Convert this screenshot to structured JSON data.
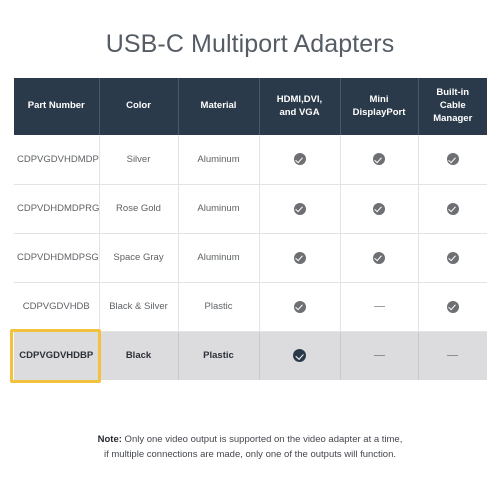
{
  "title": "USB-C Multiport Adapters",
  "colors": {
    "header_bg": "#2b3a4a",
    "highlight_border": "#f2c23e",
    "highlight_row_bg": "#dcdcde",
    "check_gray": "#6d6f72",
    "check_dark": "#2b3a4a",
    "title_text": "#555c66"
  },
  "table": {
    "columns": [
      {
        "label": "Part Number"
      },
      {
        "label": "Color"
      },
      {
        "label": "Material"
      },
      {
        "label": "HDMI,DVI,\nand VGA"
      },
      {
        "label": "Mini\nDisplayPort"
      },
      {
        "label": "Built-in Cable\nManager"
      }
    ],
    "column_labels_lines": [
      [
        "Part Number"
      ],
      [
        "Color"
      ],
      [
        "Material"
      ],
      [
        "HDMI,DVI,",
        "and VGA"
      ],
      [
        "Mini",
        "DisplayPort"
      ],
      [
        "Built-in Cable",
        "Manager"
      ]
    ],
    "rows": [
      {
        "part_number": "CDPVGDVHDMDP",
        "color": "Silver",
        "material": "Aluminum",
        "hdmi_dvi_vga": "check",
        "mini_displayport": "check",
        "built_in_cable_manager": "check",
        "highlighted": false
      },
      {
        "part_number": "CDPVDHDMDPRG",
        "color": "Rose Gold",
        "material": "Aluminum",
        "hdmi_dvi_vga": "check",
        "mini_displayport": "check",
        "built_in_cable_manager": "check",
        "highlighted": false
      },
      {
        "part_number": "CDPVDHDMDPSG",
        "color": "Space Gray",
        "material": "Aluminum",
        "hdmi_dvi_vga": "check",
        "mini_displayport": "check",
        "built_in_cable_manager": "check",
        "highlighted": false
      },
      {
        "part_number": "CDPVGDVHDB",
        "color": "Black & Silver",
        "material": "Plastic",
        "hdmi_dvi_vga": "check",
        "mini_displayport": "dash",
        "built_in_cable_manager": "check",
        "highlighted": false
      },
      {
        "part_number": "CDPVGDVHDBP",
        "color": "Black",
        "material": "Plastic",
        "hdmi_dvi_vga": "check",
        "mini_displayport": "dash",
        "built_in_cable_manager": "dash",
        "highlighted": true
      }
    ]
  },
  "footer": {
    "note_label": "Note:",
    "line1": " Only one video output is supported on the video adapter at a time,",
    "line2": "if multiple connections are made, only one of the outputs will function."
  }
}
